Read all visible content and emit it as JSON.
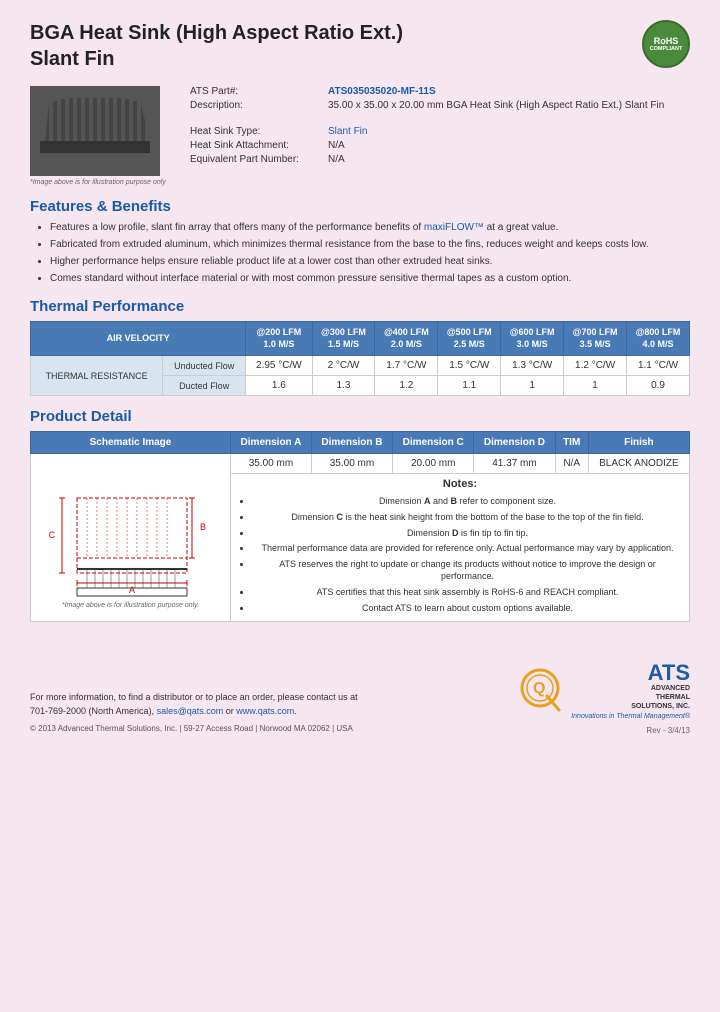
{
  "page": {
    "title_line1": "BGA Heat Sink (High Aspect Ratio Ext.)",
    "title_line2": "Slant Fin",
    "rohs": {
      "main": "RoHS",
      "sub": "COMPLIANT"
    },
    "part_number_label": "ATS Part#:",
    "part_number_value": "ATS035035020-MF-11S",
    "description_label": "Description:",
    "description_value": "35.00 x 35.00 x 20.00 mm BGA Heat Sink (High Aspect Ratio Ext.) Slant Fin",
    "heatsink_type_label": "Heat Sink Type:",
    "heatsink_type_value": "Slant Fin",
    "heatsink_attachment_label": "Heat Sink Attachment:",
    "heatsink_attachment_value": "N/A",
    "equivalent_part_label": "Equivalent Part Number:",
    "equivalent_part_value": "N/A",
    "image_caption": "*Image above is for illustration purpose only",
    "features_title": "Features & Benefits",
    "features": [
      "Features a low profile, slant fin array that offers many of the performance benefits of maxiFLOW™ at a great value.",
      "Fabricated from extruded aluminum, which minimizes thermal resistance from the base to the fins, reduces weight and keeps costs low.",
      "Higher performance helps ensure reliable product life at a lower cost than other extruded heat sinks.",
      "Comes standard without interface material or with most common pressure sensitive thermal tapes as a custom option."
    ],
    "thermal_title": "Thermal Performance",
    "thermal_table": {
      "header_row1": [
        "AIR VELOCITY",
        "@200 LFM 1.0 M/S",
        "@300 LFM 1.5 M/S",
        "@400 LFM 2.0 M/S",
        "@500 LFM 2.5 M/S",
        "@600 LFM 3.0 M/S",
        "@700 LFM 3.5 M/S",
        "@800 LFM 4.0 M/S"
      ],
      "row_label": "THERMAL RESISTANCE",
      "unducted_label": "Unducted Flow",
      "unducted_values": [
        "2.95 °C/W",
        "2 °C/W",
        "1.7 °C/W",
        "1.5 °C/W",
        "1.3 °C/W",
        "1.2 °C/W",
        "1.1 °C/W"
      ],
      "ducted_label": "Ducted Flow",
      "ducted_values": [
        "1.6",
        "1.3",
        "1.2",
        "1.1",
        "1",
        "1",
        "0.9"
      ]
    },
    "product_detail_title": "Product Detail",
    "product_detail_headers": [
      "Schematic Image",
      "Dimension A",
      "Dimension B",
      "Dimension C",
      "Dimension D",
      "TIM",
      "Finish"
    ],
    "product_detail_values": [
      "35.00 mm",
      "35.00 mm",
      "20.00 mm",
      "41.37 mm",
      "N/A",
      "BLACK ANODIZE"
    ],
    "notes_title": "Notes:",
    "notes": [
      "Dimension A and B refer to component size.",
      "Dimension C is the heat sink height from the bottom of the base to the top of the fin field.",
      "Dimension D is fin tip to fin tip.",
      "Thermal performance data are provided for reference only. Actual performance may vary by application.",
      "ATS reserves the right to update or change its products without notice to improve the design or performance.",
      "ATS certifies that this heat sink assembly is RoHS-6 and REACH compliant.",
      "Contact ATS to learn about custom options available."
    ],
    "schematic_caption": "*Image above is for illustration purpose only.",
    "footer": {
      "contact_text": "For more information, to find a distributor or to place an order, please contact us at\n701-769-2000 (North America),",
      "email": "sales@qats.com",
      "or_text": " or ",
      "website": "www.qats.com",
      "period": ".",
      "copyright": "© 2013 Advanced Thermal Solutions, Inc.  |  59-27 Access Road  |  Norwood MA  02062  |  USA",
      "rev": "Rev - 3/4/13"
    },
    "ats_logo": {
      "q_letter": "Q",
      "ats_letters": "ATS",
      "company_name": "ADVANCED\nTHERMAL\nSOLUTIONS, INC.",
      "tagline": "Innovations in Thermal Management®"
    }
  }
}
